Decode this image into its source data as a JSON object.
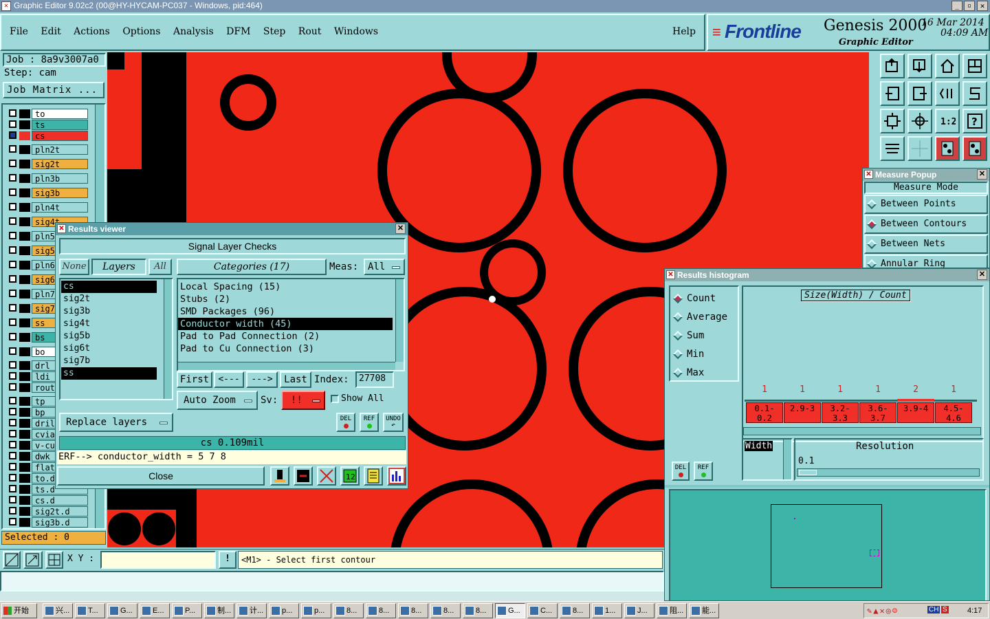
{
  "window": {
    "title": "Graphic Editor 9.02c2 (00@HY-HYCAM-PC037 - Windows, pid:464)"
  },
  "menu": {
    "items": [
      "File",
      "Edit",
      "Actions",
      "Options",
      "Analysis",
      "DFM",
      "Step",
      "Rout",
      "Windows"
    ],
    "help": "Help"
  },
  "brand": {
    "logo": "Frontline",
    "product": "Genesis 2000",
    "subtitle": "Graphic Editor",
    "date": "16 Mar 2014",
    "time": "04:09 AM"
  },
  "job": {
    "job_label": "Job : 8a9v3007a0",
    "step_label": "Step: cam",
    "matrix_button": "Job Matrix ...",
    "selected": "Selected : 0"
  },
  "layers": [
    {
      "name": "to",
      "color": "#ffffff"
    },
    {
      "name": "ts",
      "color": "#3cb4a8"
    },
    {
      "name": "cs",
      "color": "#f03028"
    },
    {
      "name": "pln2t",
      "color": "#9ed8d8"
    },
    {
      "name": "sig2t",
      "color": "#f0b040"
    },
    {
      "name": "pln3b",
      "color": "#9ed8d8"
    },
    {
      "name": "sig3b",
      "color": "#f0b040"
    },
    {
      "name": "pln4t",
      "color": "#9ed8d8"
    },
    {
      "name": "sig4t",
      "color": "#f0b040"
    },
    {
      "name": "pln5b",
      "color": "#9ed8d8"
    },
    {
      "name": "sig5b",
      "color": "#f0b040"
    },
    {
      "name": "pln6t",
      "color": "#9ed8d8"
    },
    {
      "name": "sig6t",
      "color": "#f0b040"
    },
    {
      "name": "pln7b",
      "color": "#9ed8d8"
    },
    {
      "name": "sig7b",
      "color": "#f0b040"
    },
    {
      "name": "ss",
      "color": "#f0b040"
    },
    {
      "name": "bs",
      "color": "#3cb4a8"
    },
    {
      "name": "bo",
      "color": "#ffffff"
    },
    {
      "name": "drl",
      "color": "#9ed8d8"
    },
    {
      "name": "ldi",
      "color": "#9ed8d8"
    },
    {
      "name": "rout",
      "color": "#9ed8d8"
    },
    {
      "name": "tp",
      "color": "#9ed8d8"
    },
    {
      "name": "bp",
      "color": "#9ed8d8"
    },
    {
      "name": "drill",
      "color": "#9ed8d8"
    },
    {
      "name": "cvia",
      "color": "#9ed8d8"
    },
    {
      "name": "v-cut",
      "color": "#9ed8d8"
    },
    {
      "name": "dwk",
      "color": "#9ed8d8"
    },
    {
      "name": "flatt",
      "color": "#9ed8d8"
    },
    {
      "name": "to.d",
      "color": "#9ed8d8"
    },
    {
      "name": "ts.d",
      "color": "#9ed8d8"
    },
    {
      "name": "cs.d",
      "color": "#9ed8d8"
    },
    {
      "name": "sig2t.d",
      "color": "#9ed8d8"
    },
    {
      "name": "sig3b.d",
      "color": "#9ed8d8"
    }
  ],
  "results_viewer": {
    "title": "Results viewer",
    "heading": "Signal Layer Checks",
    "none_btn": "None",
    "layers_btn": "Layers",
    "all_btn": "All",
    "categories_btn": "Categories (17)",
    "meas_label": "Meas:",
    "meas_value": "All",
    "layer_list": [
      "cs",
      "sig2t",
      "sig3b",
      "sig4t",
      "sig5b",
      "sig6t",
      "sig7b",
      "ss"
    ],
    "category_list": [
      "Local Spacing (15)",
      "Stubs (2)",
      "SMD Packages (96)",
      "Conductor width (45)",
      "Pad to Pad Connection (2)",
      "Pad to Cu Connection (3)"
    ],
    "first_btn": "First",
    "prev_btn": "<---",
    "next_btn": "--->",
    "last_btn": "Last",
    "index_label": "Index:",
    "index_value": "27708",
    "auto_zoom": "Auto Zoom",
    "sv_label": "Sv:",
    "sv_value": "!!",
    "show_all": "Show All",
    "replace_layers": "Replace layers",
    "del": "DEL",
    "ref": "REF",
    "undo": "UNDO",
    "status": "cs 0.109mil",
    "erf": "ERF--> conductor_width = 5 7 8",
    "close": "Close"
  },
  "measure_popup": {
    "title": "Measure Popup",
    "heading": "Measure Mode",
    "options": [
      "Between Points",
      "Between Contours",
      "Between Nets",
      "Annular Ring"
    ]
  },
  "histogram": {
    "title": "Results histogram",
    "modes": [
      "Count",
      "Average",
      "Sum",
      "Min",
      "Max"
    ],
    "chart_title": "Size(Width) / Count",
    "counts": [
      "1",
      "1",
      "1",
      "1",
      "2",
      "1"
    ],
    "bins": [
      "0.1-0.2",
      "2.9-3",
      "3.2-3.3",
      "3.6-3.7",
      "3.9-4",
      "4.5-4.6"
    ],
    "width_label": "Width",
    "resolution_label": "Resolution",
    "resolution_value": "0.1",
    "del": "DEL",
    "ref": "REF"
  },
  "chart_data": {
    "type": "bar",
    "title": "Size(Width) / Count",
    "categories": [
      "0.1-0.2",
      "2.9-3",
      "3.2-3.3",
      "3.6-3.7",
      "3.9-4",
      "4.5-4.6"
    ],
    "values": [
      1,
      1,
      1,
      1,
      2,
      1
    ]
  },
  "statusbar": {
    "xy_label": "X Y :",
    "xy_value": "",
    "warn": "!",
    "prompt": "<M1> - Select first contour"
  },
  "taskbar": {
    "start": "开始",
    "tasks": [
      "兴...",
      "T...",
      "G...",
      "E...",
      "P...",
      "制...",
      "计...",
      "p...",
      "p...",
      "8...",
      "8...",
      "8...",
      "8...",
      "8...",
      "G...",
      "C...",
      "8...",
      "1...",
      "J...",
      "阻...",
      "能..."
    ],
    "clock": "4:17"
  }
}
